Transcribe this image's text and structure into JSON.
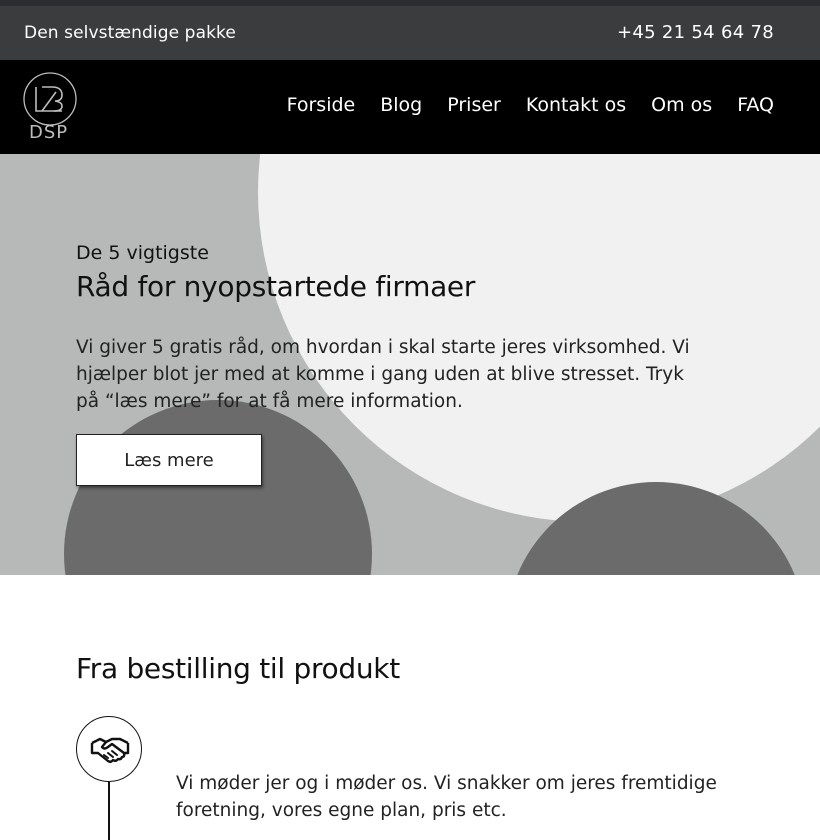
{
  "topbar": {
    "tagline": "Den selvstændige pakke",
    "phone": "+45 21 54 64 78"
  },
  "logo": {
    "text": "DSP"
  },
  "nav": {
    "items": [
      "Forside",
      "Blog",
      "Priser",
      "Kontakt os",
      "Om os",
      "FAQ"
    ]
  },
  "hero": {
    "eyebrow": "De 5 vigtigste",
    "title": "Råd for nyopstartede firmaer",
    "description": "Vi giver 5 gratis råd, om hvordan i skal starte jeres virksomhed. Vi hjælper blot jer med at komme i gang uden at blive stresset. Tryk på “læs mere” for at få mere information.",
    "cta_label": "Læs mere"
  },
  "process": {
    "title": "Fra bestilling til produkt",
    "steps": [
      {
        "icon": "handshake-icon",
        "text": "Vi møder jer og i møder os. Vi snakker om jeres fremtidige foretning, vores egne plan, pris etc."
      }
    ]
  },
  "colors": {
    "topbar_bg": "#3b3c3e",
    "nav_bg": "#000000",
    "hero_bg": "#b7b9b9",
    "hero_light_circle": "#f1f1f1",
    "hero_dark_circle": "#6b6b6b"
  }
}
